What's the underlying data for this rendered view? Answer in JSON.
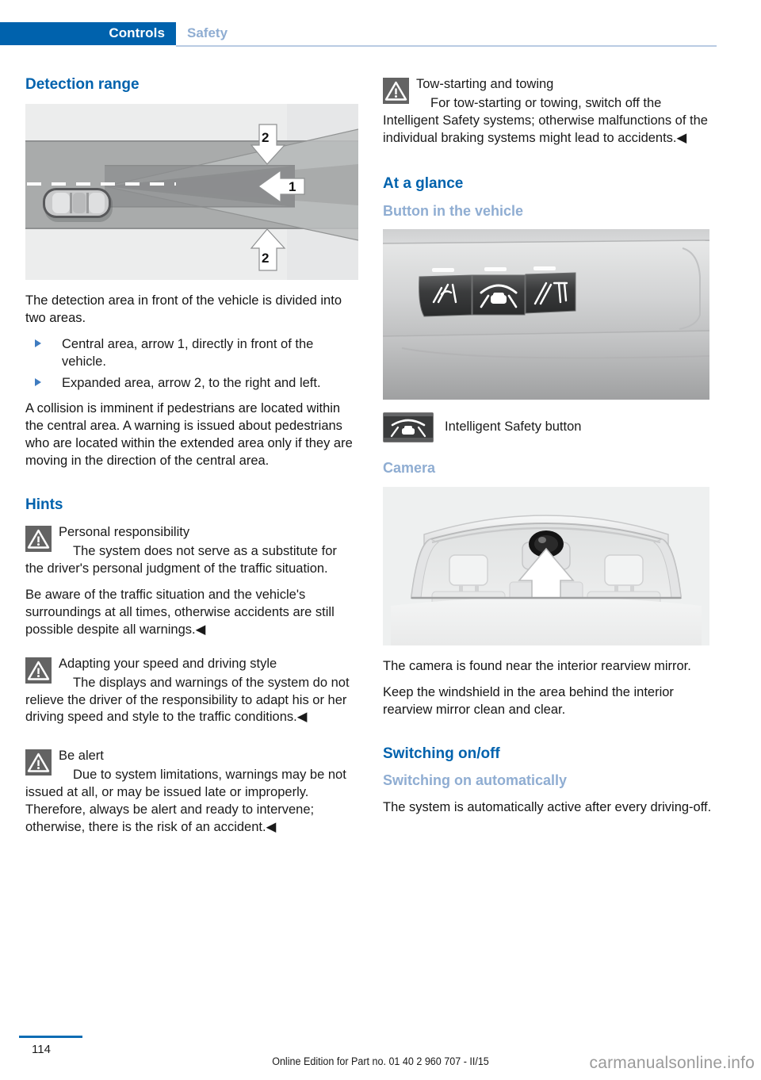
{
  "header": {
    "active_tab": "Controls",
    "inactive_tab": "Safety",
    "accent_color": "#0062ad",
    "muted_color": "#8fadd2"
  },
  "left_column": {
    "heading_detection": "Detection range",
    "figure_detection": {
      "name": "detection-range-diagram",
      "callouts": [
        {
          "label": "1",
          "meaning": "Central area directly in front of the vehicle"
        },
        {
          "label": "2",
          "meaning": "Expanded area to the right and left"
        }
      ]
    },
    "intro": "The detection area in front of the vehicle is divided into two areas.",
    "bullets": [
      "Central area, arrow 1, directly in front of the vehicle.",
      "Expanded area, arrow 2, to the right and left."
    ],
    "collision_paragraph": "A collision is imminent if pedestrians are located within the central area. A warning is issued about pedestrians who are located within the extended area only if they are moving in the direction of the central area.",
    "heading_hints": "Hints",
    "warnings": [
      {
        "title": "Personal responsibility",
        "text": "The system does not serve as a substitute for the driver's personal judgment of the traffic situation.",
        "continuation": "Be aware of the traffic situation and the vehicle's surroundings at all times, otherwise accidents are still possible despite all warnings.◀"
      },
      {
        "title": "Adapting your speed and driving style",
        "text": "The displays and warnings of the system do not relieve the driver of the responsibility to adapt his or her driving speed and style to the traffic conditions.◀",
        "continuation": ""
      },
      {
        "title": "Be alert",
        "text": "Due to system limitations, warnings may be not issued at all, or may be issued late or improperly. Therefore, always be alert and ready to intervene; otherwise, there is the risk of an accident.◀",
        "continuation": ""
      }
    ]
  },
  "right_column": {
    "warning_tow": {
      "title": "Tow-starting and towing",
      "text": "For tow-starting or towing, switch off the Intelligent Safety systems; otherwise malfunctions of the individual braking systems might lead to accidents.◀"
    },
    "heading_at_a_glance": "At a glance",
    "heading_button": "Button in the vehicle",
    "figure_button": {
      "name": "vehicle-button-panel-photo"
    },
    "legend_button_label": "Intelligent Safety button",
    "heading_camera": "Camera",
    "figure_camera": {
      "name": "windshield-camera-photo"
    },
    "camera_paragraph_1": "The camera is found near the interior rearview mirror.",
    "camera_paragraph_2": "Keep the windshield in the area behind the interior rearview mirror clean and clear.",
    "heading_switching": "Switching on/off",
    "heading_switching_auto": "Switching on automatically",
    "switching_paragraph": "The system is automatically active after every driving-off."
  },
  "footer": {
    "page_number": "114",
    "edition": "Online Edition for Part no. 01 40 2 960 707 - II/15",
    "watermark": "carmanualsonline.info"
  }
}
